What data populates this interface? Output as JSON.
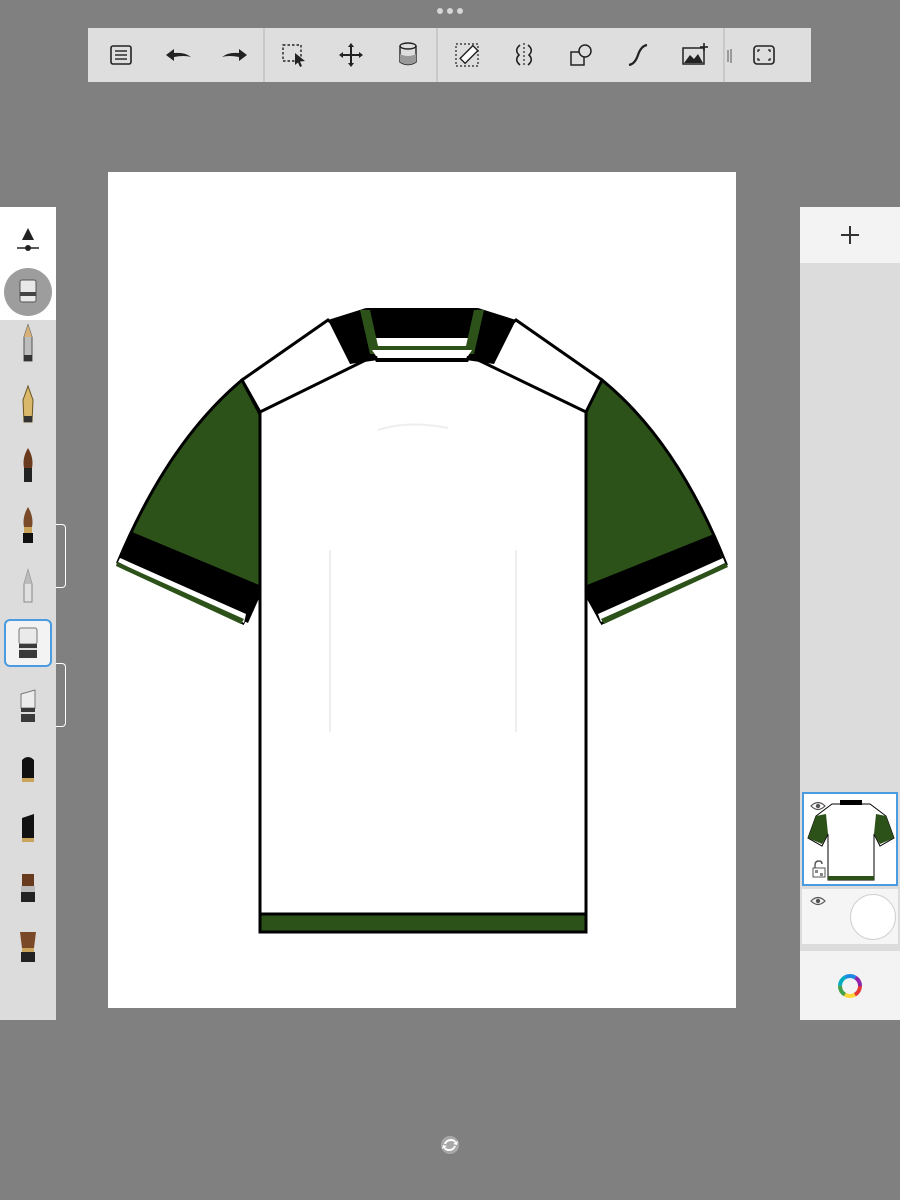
{
  "app": {
    "toolbar_tools": [
      "menu-list-icon",
      "undo-icon",
      "redo-icon",
      "selection-icon",
      "transform-icon",
      "fill-bucket-icon",
      "ruler-icon",
      "symmetry-icon",
      "shapes-icon",
      "curve-icon",
      "add-image-icon",
      "fullscreen-icon"
    ],
    "brushes": [
      "pencil",
      "ballpoint-pen",
      "fountain-pen",
      "paint-brush",
      "ink-brush",
      "airbrush",
      "eraser",
      "soft-eraser",
      "marker",
      "chisel-marker",
      "flat-brush",
      "fan-brush"
    ],
    "selected_brush": "eraser",
    "layers": [
      {
        "name": "shirt-layer",
        "visible": true,
        "active": true
      },
      {
        "name": "background-layer",
        "visible": true,
        "active": false
      }
    ]
  },
  "colors": {
    "ui_gray": "#808080",
    "panel": "#dcdcdc",
    "accent_blue": "#4a9be0",
    "shirt_green": "#2c5219",
    "shirt_black": "#000000",
    "shirt_white": "#ffffff"
  }
}
